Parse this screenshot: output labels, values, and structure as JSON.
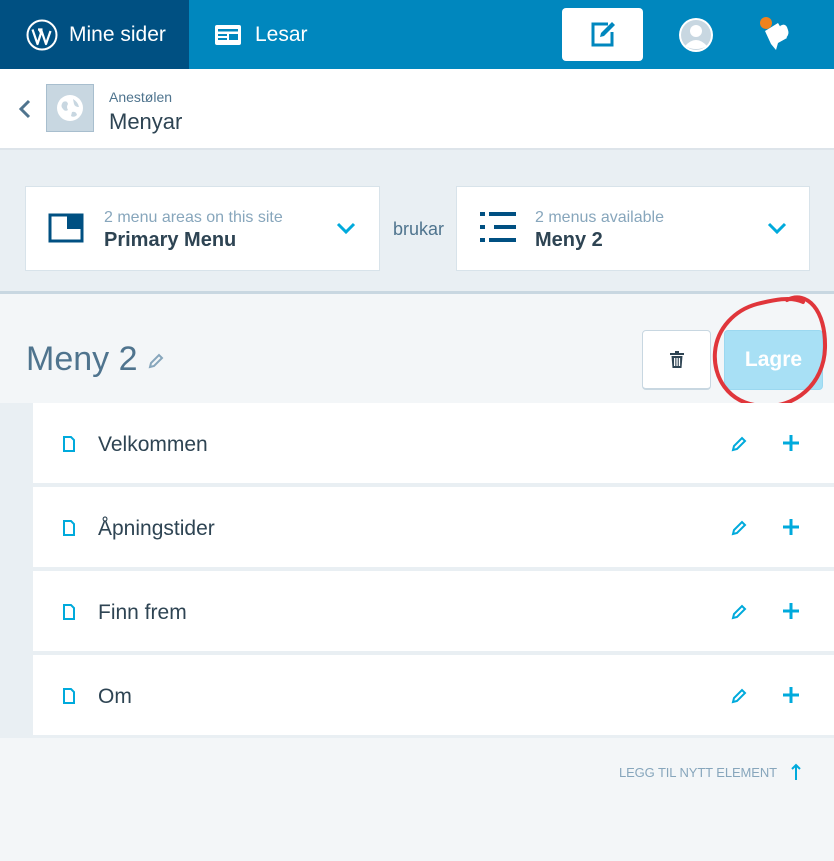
{
  "masterbar": {
    "my_sites_label": "Mine sider",
    "reader_label": "Lesar",
    "write_icon": "write-icon",
    "notifications_icon": "notifications-icon"
  },
  "site": {
    "name": "Anestølen",
    "section": "Menyar"
  },
  "location": {
    "area_sub": "2 menu areas on this site",
    "area_main": "Primary Menu",
    "connector": "brukar",
    "menu_sub": "2 menus available",
    "menu_main": "Meny 2"
  },
  "menu": {
    "title": "Meny 2",
    "save_label": "Lagre",
    "items": [
      {
        "label": "Velkommen"
      },
      {
        "label": "Åpningstider"
      },
      {
        "label": "Finn frem"
      },
      {
        "label": "Om"
      }
    ],
    "add_new_label": "LEGG TIL NYTT ELEMENT"
  },
  "colors": {
    "masterbar": "#0087be",
    "masterbar_active": "#005082",
    "accent": "#00aadc",
    "save_disabled": "#a8e0f5",
    "annotation": "#e0363b"
  }
}
